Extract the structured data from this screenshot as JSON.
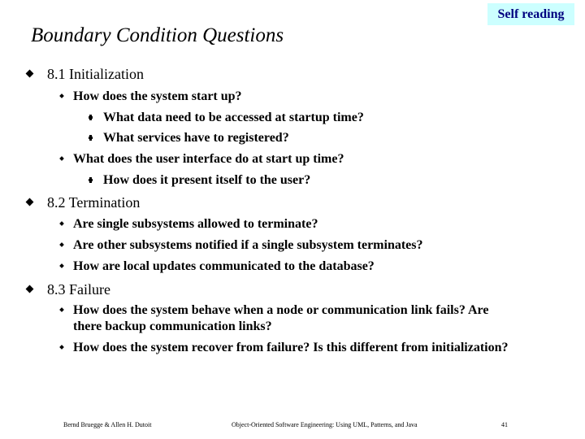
{
  "badge": "Self reading",
  "title": "Boundary Condition Questions",
  "sections": [
    {
      "label": "8.1 Initialization",
      "items": [
        {
          "text": "How does the system start up?",
          "subitems": [
            "What data need to be accessed at startup time?",
            "What services have to registered?"
          ]
        },
        {
          "text": "What does the user interface do at start up time?",
          "subitems": [
            "How does it present itself to the user?"
          ]
        }
      ]
    },
    {
      "label": "8.2 Termination",
      "items": [
        {
          "text": "Are single subsystems allowed to terminate?"
        },
        {
          "text": "Are other subsystems notified if a single subsystem terminates?"
        },
        {
          "text": "How are local updates communicated to the database?"
        }
      ]
    },
    {
      "label": "8.3 Failure",
      "items": [
        {
          "text": "How does the system behave when a node or communication link fails? Are",
          "text_cont": "there backup communication links?"
        },
        {
          "text": "How does the system recover from failure? Is this different from initialization?"
        }
      ]
    }
  ],
  "footer": {
    "authors": "Bernd Bruegge & Allen H. Dutoit",
    "book": "Object-Oriented Software Engineering: Using UML, Patterns, and Java",
    "page": "41"
  }
}
